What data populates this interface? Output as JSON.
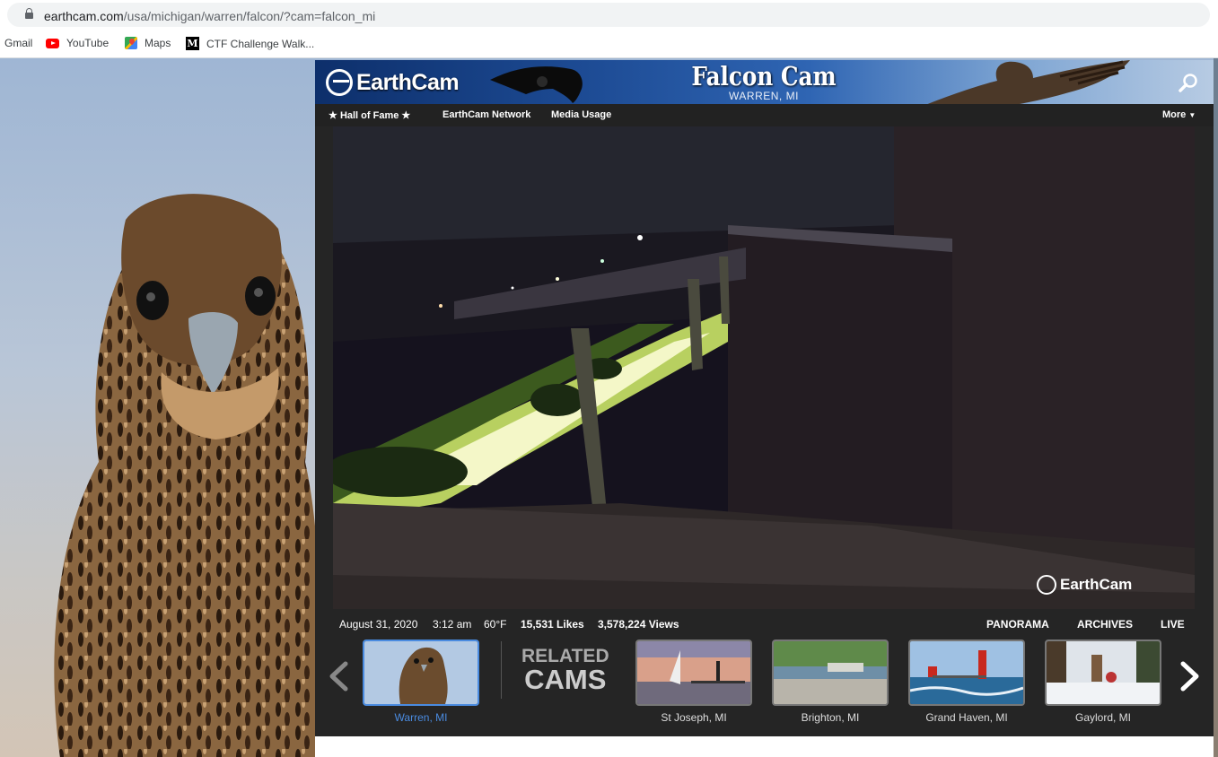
{
  "browser": {
    "url_host": "earthcam.com",
    "url_path": "/usa/michigan/warren/falcon/?cam=falcon_mi",
    "bookmarks": [
      {
        "label": "Gmail"
      },
      {
        "label": "YouTube"
      },
      {
        "label": "Maps"
      },
      {
        "label": "CTF Challenge Walk..."
      }
    ]
  },
  "header": {
    "logo": "EarthCam",
    "title": "Falcon Cam",
    "subtitle": "WARREN, MI"
  },
  "nav": {
    "hall_of_fame": "Hall of Fame",
    "network": "EarthCam Network",
    "media_usage": "Media Usage",
    "more": "More"
  },
  "video": {
    "watermark": "EarthCam"
  },
  "info": {
    "date": "August 31, 2020",
    "time": "3:12 am",
    "temp": "60°F",
    "likes": "15,531 Likes",
    "views": "3,578,224 Views",
    "panorama": "PANORAMA",
    "archives": "ARCHIVES",
    "live": "LIVE"
  },
  "related": {
    "line1": "RELATED",
    "line2": "CAMS",
    "current": "Warren, MI",
    "cams": [
      {
        "label": "St Joseph, MI"
      },
      {
        "label": "Brighton, MI"
      },
      {
        "label": "Grand Haven, MI"
      },
      {
        "label": "Gaylord, MI"
      }
    ]
  }
}
